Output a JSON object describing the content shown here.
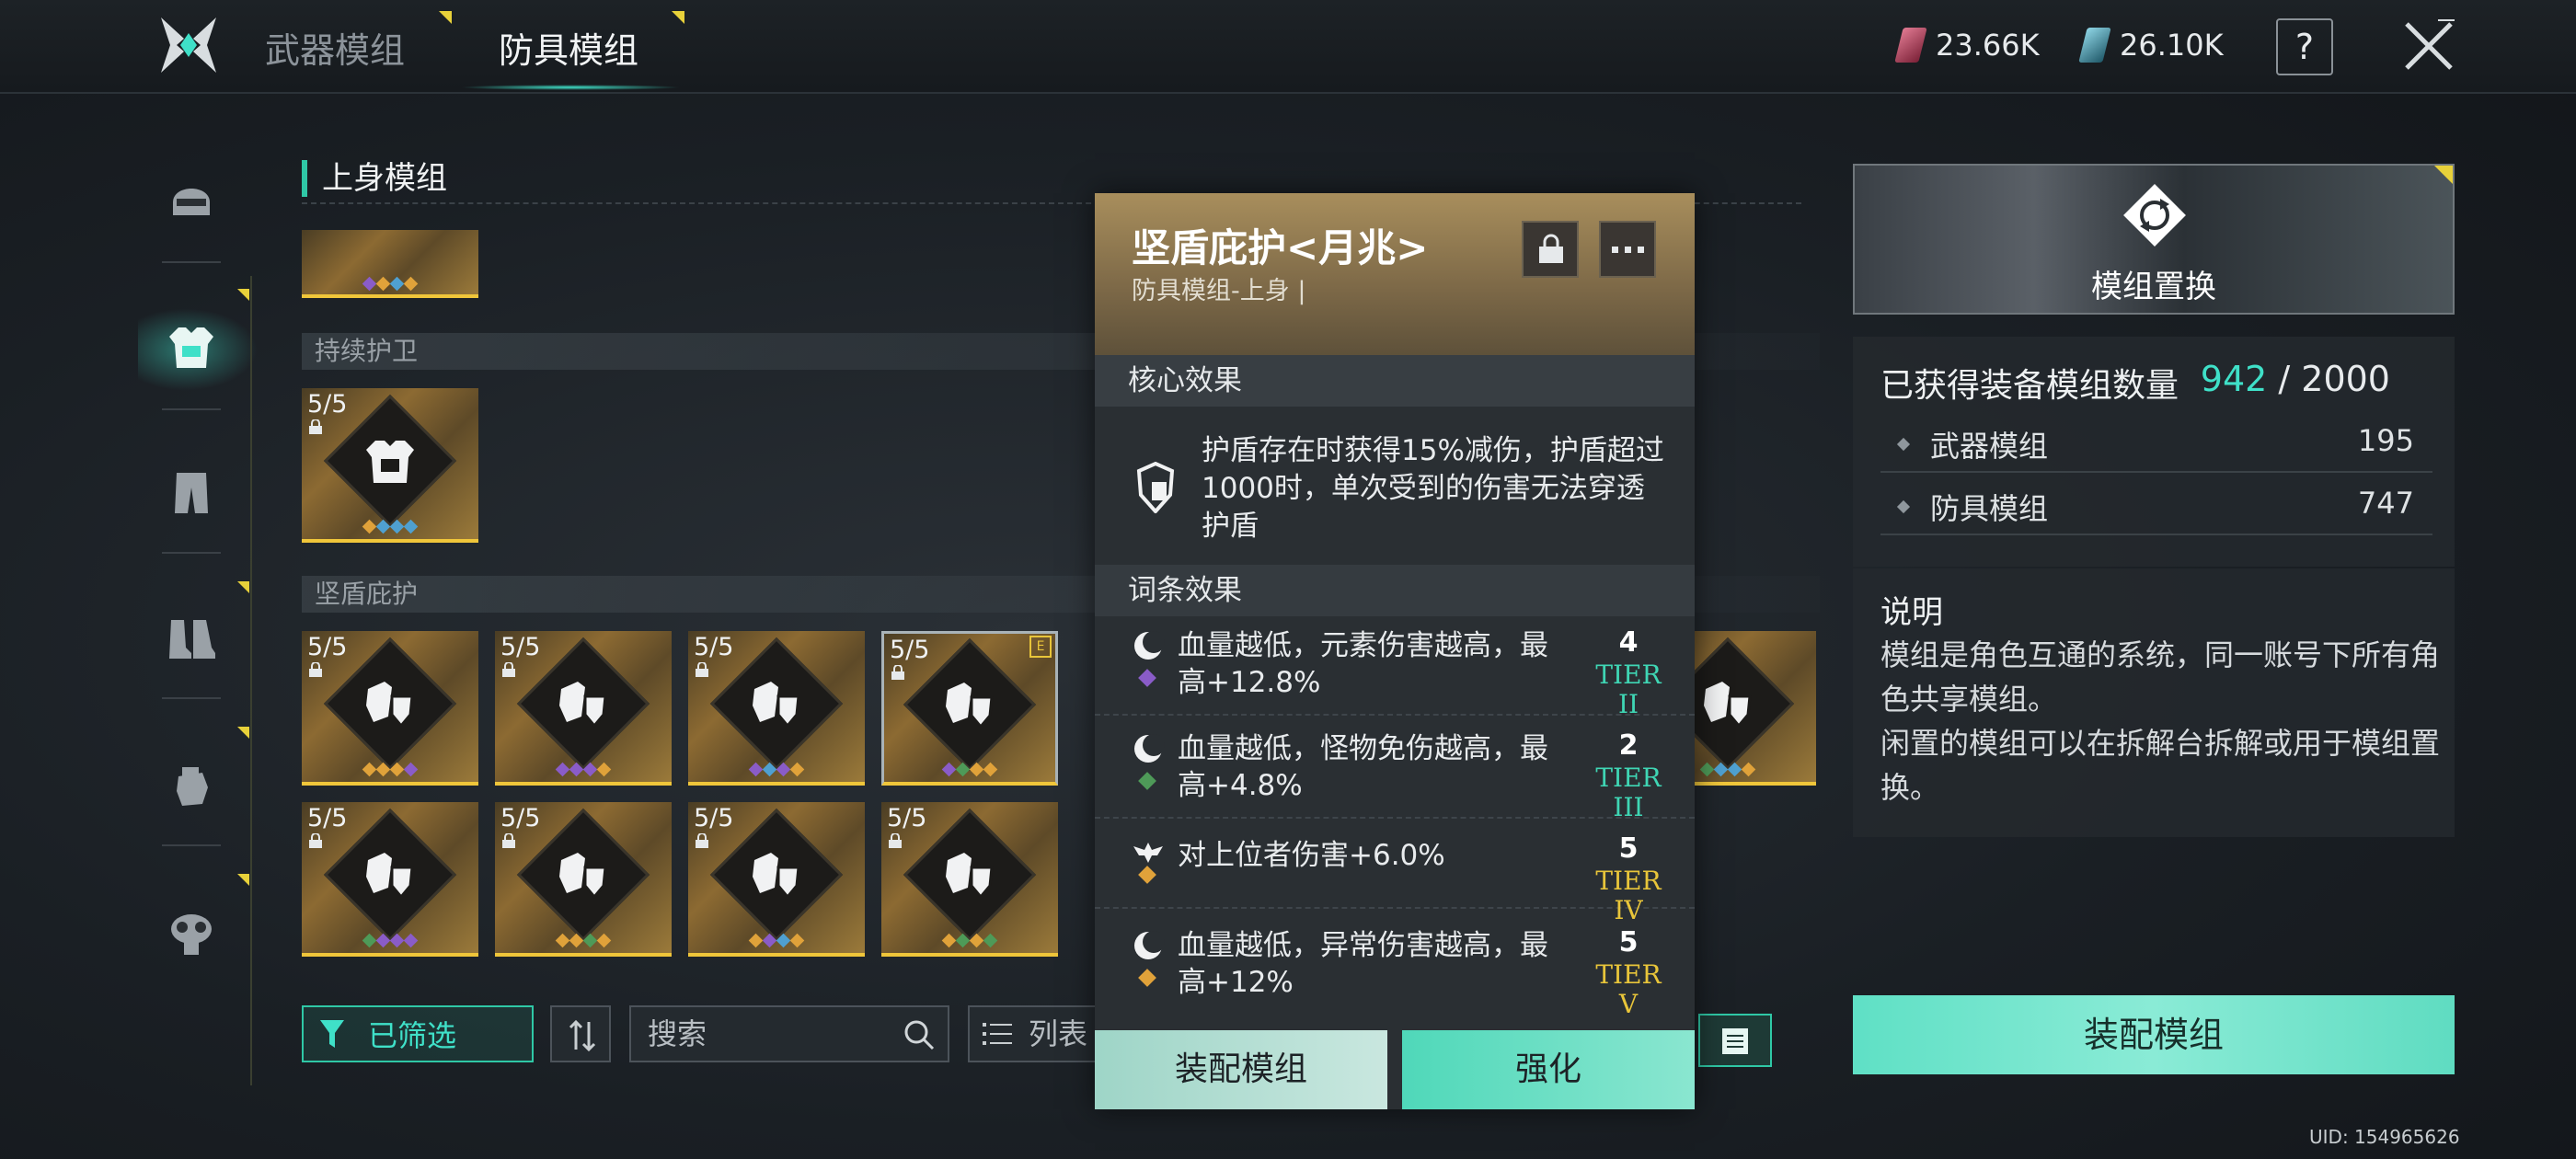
{
  "top": {
    "tabs": [
      {
        "label": "武器模组",
        "active": false
      },
      {
        "label": "防具模组",
        "active": true
      }
    ],
    "currencies": [
      {
        "icon": "red-crystal-icon",
        "value": "23.66K",
        "color": "#c23a58"
      },
      {
        "icon": "blue-crystal-icon",
        "value": "26.10K",
        "color": "#3f8fa8"
      }
    ],
    "help_label": "?"
  },
  "nav": {
    "items": [
      {
        "name": "helmet",
        "active": false
      },
      {
        "name": "body-armor",
        "active": true
      },
      {
        "name": "pants",
        "active": false
      },
      {
        "name": "boots",
        "active": false
      },
      {
        "name": "gloves",
        "active": false
      },
      {
        "name": "gas-mask",
        "active": false
      }
    ]
  },
  "list": {
    "section_title": "上身模组",
    "groups": [
      {
        "title": "持续护卫"
      },
      {
        "title": "坚盾庇护"
      }
    ],
    "cards": {
      "count_text": "5/5",
      "badge_e": "E"
    }
  },
  "toolbar": {
    "filter_label": "已筛选",
    "search_placeholder": "搜索",
    "view_label": "列表"
  },
  "popup": {
    "title": "坚盾庇护<月兆>",
    "subtitle": "防具模组-上身 |",
    "core_header": "核心效果",
    "core_text": "护盾存在时获得15%减伤，护盾超过1000时，单次受到的伤害无法穿透护盾",
    "traits_header": "词条效果",
    "traits": [
      {
        "text": "血量越低，元素伤害越高，最高+12.8%",
        "level": "4",
        "tier": "TIER II",
        "dot_color": "#8a5cc8",
        "tier_color": "#3fd6b4"
      },
      {
        "text": "血量越低，怪物免伤越高，最高+4.8%",
        "level": "2",
        "tier": "TIER III",
        "dot_color": "#4e9a58",
        "tier_color": "#3fd6b4"
      },
      {
        "text": "对上位者伤害+6.0%",
        "level": "5",
        "tier": "TIER IV",
        "dot_color": "#e0a23a",
        "tier_color": "#e8c53a"
      },
      {
        "text": "血量越低，异常伤害越高，最高+12%",
        "level": "5",
        "tier": "TIER V",
        "dot_color": "#e0a23a",
        "tier_color": "#e8c53a"
      }
    ],
    "equip_label": "装配模组",
    "enhance_label": "强化"
  },
  "right": {
    "swap_label": "模组置换",
    "stats_title": "已获得装备模组数量",
    "stats_current": "942",
    "stats_sep": " / ",
    "stats_total": "2000",
    "rows": [
      {
        "label": "武器模组",
        "value": "195"
      },
      {
        "label": "防具模组",
        "value": "747"
      }
    ],
    "desc_title": "说明",
    "desc_lines": [
      "模组是角色互通的系统，同一账号下所有角色共享模组。",
      "闲置的模组可以在拆解台拆解或用于模组置换。"
    ],
    "equip_label": "装配模组"
  },
  "uid": "UID: 154965626"
}
